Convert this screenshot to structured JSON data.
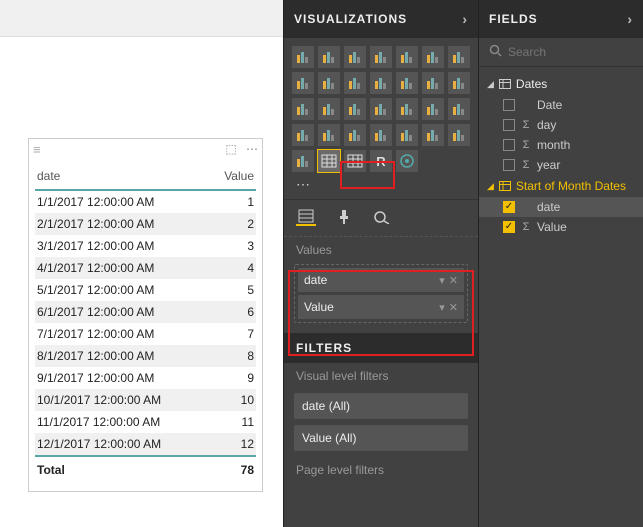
{
  "canvas": {
    "table": {
      "headers": {
        "c1": "date",
        "c2": "Value"
      },
      "rows": [
        {
          "c1": "1/1/2017 12:00:00 AM",
          "c2": "1"
        },
        {
          "c1": "2/1/2017 12:00:00 AM",
          "c2": "2"
        },
        {
          "c1": "3/1/2017 12:00:00 AM",
          "c2": "3"
        },
        {
          "c1": "4/1/2017 12:00:00 AM",
          "c2": "4"
        },
        {
          "c1": "5/1/2017 12:00:00 AM",
          "c2": "5"
        },
        {
          "c1": "6/1/2017 12:00:00 AM",
          "c2": "6"
        },
        {
          "c1": "7/1/2017 12:00:00 AM",
          "c2": "7"
        },
        {
          "c1": "8/1/2017 12:00:00 AM",
          "c2": "8"
        },
        {
          "c1": "9/1/2017 12:00:00 AM",
          "c2": "9"
        },
        {
          "c1": "10/1/2017 12:00:00 AM",
          "c2": "10"
        },
        {
          "c1": "11/1/2017 12:00:00 AM",
          "c2": "11"
        },
        {
          "c1": "12/1/2017 12:00:00 AM",
          "c2": "12"
        }
      ],
      "footer": {
        "c1": "Total",
        "c2": "78"
      }
    }
  },
  "viz": {
    "title": "VISUALIZATIONS",
    "values_label": "Values",
    "value_fields": [
      {
        "label": "date"
      },
      {
        "label": "Value"
      }
    ],
    "filters_title": "FILTERS",
    "visual_filters_label": "Visual level filters",
    "page_filters_label": "Page level filters",
    "filters": [
      {
        "label": "date (All)"
      },
      {
        "label": "Value (All)"
      }
    ],
    "icons": [
      "stacked-bar-chart-icon",
      "stacked-column-chart-icon",
      "clustered-bar-chart-icon",
      "clustered-column-chart-icon",
      "100-stacked-bar-chart-icon",
      "100-stacked-column-chart-icon",
      "line-chart-icon",
      "area-chart-icon",
      "stacked-area-chart-icon",
      "line-clustered-column-icon",
      "line-stacked-column-icon",
      "ribbon-chart-icon",
      "waterfall-chart-icon",
      "scatter-chart-icon",
      "pie-chart-icon",
      "donut-chart-icon",
      "treemap-icon",
      "map-icon",
      "filled-map-icon",
      "funnel-chart-icon",
      "gauge-icon",
      "card-icon",
      "multirow-card-icon",
      "kpi-icon",
      "slicer-icon",
      "number-card-icon",
      "text-box-icon",
      "shape-icon",
      "mekko-chart-icon",
      "table-icon",
      "matrix-icon",
      "r-visual-icon",
      "arcgis-map-icon"
    ]
  },
  "fields": {
    "title": "FIELDS",
    "search_placeholder": "Search",
    "tables": [
      {
        "name": "Dates",
        "selected": false,
        "fields": [
          {
            "name": "Date",
            "checked": false,
            "sigma": false
          },
          {
            "name": "day",
            "checked": false,
            "sigma": true
          },
          {
            "name": "month",
            "checked": false,
            "sigma": true
          },
          {
            "name": "year",
            "checked": false,
            "sigma": true
          }
        ]
      },
      {
        "name": "Start of Month Dates",
        "selected": true,
        "fields": [
          {
            "name": "date",
            "checked": true,
            "sigma": false
          },
          {
            "name": "Value",
            "checked": true,
            "sigma": true
          }
        ]
      }
    ]
  },
  "chart_data": {
    "type": "table",
    "columns": [
      "date",
      "Value"
    ],
    "rows": [
      [
        "1/1/2017 12:00:00 AM",
        1
      ],
      [
        "2/1/2017 12:00:00 AM",
        2
      ],
      [
        "3/1/2017 12:00:00 AM",
        3
      ],
      [
        "4/1/2017 12:00:00 AM",
        4
      ],
      [
        "5/1/2017 12:00:00 AM",
        5
      ],
      [
        "6/1/2017 12:00:00 AM",
        6
      ],
      [
        "7/1/2017 12:00:00 AM",
        7
      ],
      [
        "8/1/2017 12:00:00 AM",
        8
      ],
      [
        "9/1/2017 12:00:00 AM",
        9
      ],
      [
        "10/1/2017 12:00:00 AM",
        10
      ],
      [
        "11/1/2017 12:00:00 AM",
        11
      ],
      [
        "12/1/2017 12:00:00 AM",
        12
      ]
    ],
    "totals": {
      "Value": 78
    }
  }
}
